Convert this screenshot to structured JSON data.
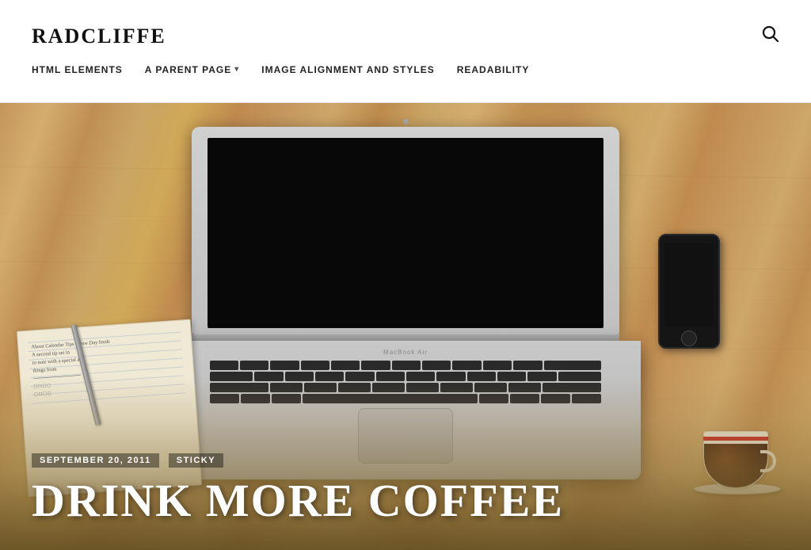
{
  "site": {
    "title": "RADCLIFFE",
    "search_icon": "🔍"
  },
  "nav": {
    "items": [
      {
        "label": "HTML ELEMENTS",
        "has_arrow": false
      },
      {
        "label": "A PARENT PAGE",
        "has_arrow": true
      },
      {
        "label": "IMAGE ALIGNMENT AND STYLES",
        "has_arrow": false
      },
      {
        "label": "READABILITY",
        "has_arrow": false
      }
    ]
  },
  "hero": {
    "date": "SEPTEMBER 20, 2011",
    "tag": "STICKY",
    "title": "DRINK MORE COFFEE"
  }
}
